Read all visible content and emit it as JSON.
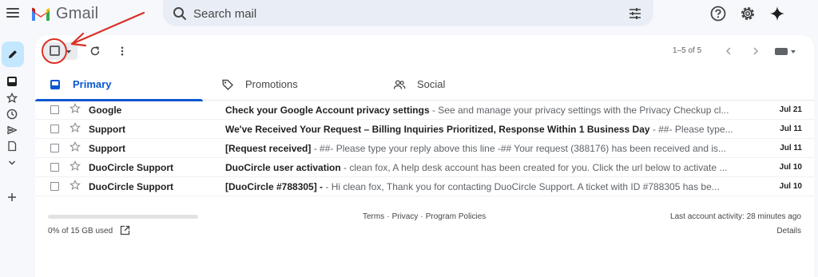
{
  "app": {
    "logo_text": "Gmail"
  },
  "search": {
    "placeholder": "Search mail"
  },
  "toolbar": {
    "pager": "1–5 of 5"
  },
  "tabs": [
    {
      "label": "Primary",
      "active": true,
      "icon": "inbox-icon"
    },
    {
      "label": "Promotions",
      "active": false,
      "icon": "tag-icon"
    },
    {
      "label": "Social",
      "active": false,
      "icon": "people-icon"
    }
  ],
  "emails": [
    {
      "sender": "Google",
      "subject": "Check your Google Account privacy settings",
      "snippet": " - See and manage your privacy settings with the Privacy Checkup cl...",
      "date": "Jul 21"
    },
    {
      "sender": "Support",
      "subject": "We've Received Your Request – Billing Inquiries Prioritized, Response Within 1 Business Day",
      "snippet": " - ##- Please type...",
      "date": "Jul 11"
    },
    {
      "sender": "Support",
      "subject": "[Request received]",
      "snippet": " - ##- Please type your reply above this line -## Your request (388176) has been received and is...",
      "date": "Jul 11"
    },
    {
      "sender": "DuoCircle Support",
      "subject": "DuoCircle user activation",
      "snippet": " - clean fox, A help desk account has been created for you. Click the url below to activate ...",
      "date": "Jul 10"
    },
    {
      "sender": "DuoCircle Support",
      "subject": "[DuoCircle #788305] -",
      "snippet": " - Hi clean fox, Thank you for contacting DuoCircle Support. A ticket with ID #788305 has be...",
      "date": "Jul 10"
    }
  ],
  "footer": {
    "storage_text": "0% of 15 GB used",
    "storage_fraction": 0,
    "links": {
      "terms": "Terms",
      "privacy": "Privacy",
      "policies": "Program Policies",
      "sep": "·"
    },
    "activity": "Last account activity: 28 minutes ago",
    "details": "Details"
  },
  "colors": {
    "accent": "#0b57d0",
    "annotation": "#d93025",
    "compose_bg": "#c2e7ff",
    "search_bg": "#e9eef6"
  }
}
